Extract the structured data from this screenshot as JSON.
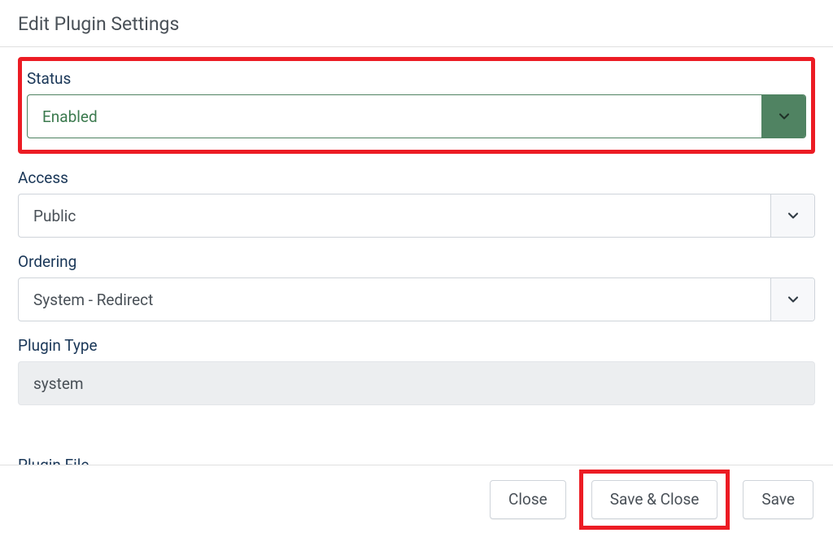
{
  "header": {
    "title": "Edit Plugin Settings"
  },
  "fields": {
    "status": {
      "label": "Status",
      "value": "Enabled"
    },
    "access": {
      "label": "Access",
      "value": "Public"
    },
    "ordering": {
      "label": "Ordering",
      "value": "System - Redirect"
    },
    "plugin_type": {
      "label": "Plugin Type",
      "value": "system"
    },
    "plugin_file": {
      "label": "Plugin File"
    }
  },
  "footer": {
    "close": "Close",
    "save_close": "Save & Close",
    "save": "Save"
  }
}
